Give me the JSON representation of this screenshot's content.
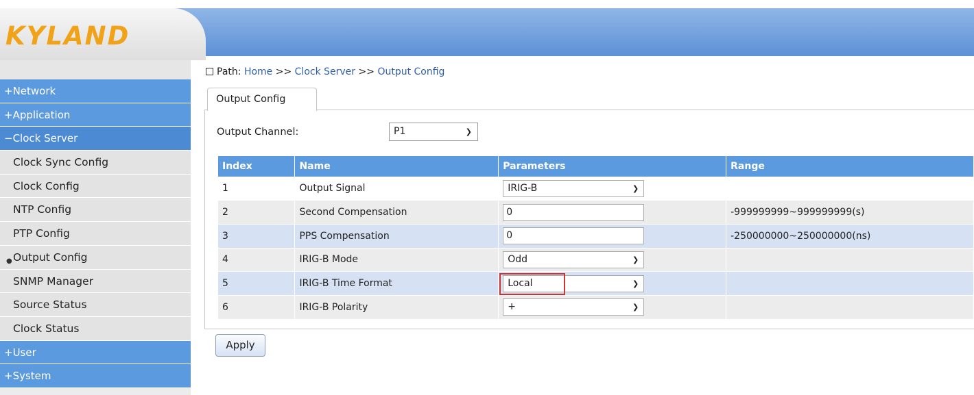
{
  "brand": {
    "logo_text": "KYLAND"
  },
  "sidebar": {
    "items": [
      {
        "label": "+Network",
        "type": "group"
      },
      {
        "label": "+Application",
        "type": "group"
      },
      {
        "label": "−Clock Server",
        "type": "group-open"
      },
      {
        "label": "Clock Sync Config",
        "type": "sub"
      },
      {
        "label": "Clock Config",
        "type": "sub"
      },
      {
        "label": "NTP Config",
        "type": "sub"
      },
      {
        "label": "PTP Config",
        "type": "sub"
      },
      {
        "label": "Output Config",
        "type": "sub-active"
      },
      {
        "label": "SNMP Manager",
        "type": "sub"
      },
      {
        "label": "Source Status",
        "type": "sub"
      },
      {
        "label": "Clock Status",
        "type": "sub"
      },
      {
        "label": "+User",
        "type": "group"
      },
      {
        "label": "+System",
        "type": "group"
      }
    ]
  },
  "path": {
    "prefix": "Path:",
    "home": "Home",
    "sep1": ">>",
    "section": "Clock Server",
    "sep2": ">>",
    "page": "Output Config"
  },
  "tab": {
    "label": "Output Config"
  },
  "channel": {
    "label": "Output Channel:",
    "value": "P1"
  },
  "table": {
    "headers": {
      "index": "Index",
      "name": "Name",
      "parameters": "Parameters",
      "range": "Range"
    },
    "rows": [
      {
        "index": "1",
        "name": "Output Signal",
        "kind": "select",
        "value": "IRIG-B",
        "range": ""
      },
      {
        "index": "2",
        "name": "Second Compensation",
        "kind": "input",
        "value": "0",
        "range": "-999999999~999999999(s)"
      },
      {
        "index": "3",
        "name": "PPS Compensation",
        "kind": "input",
        "value": "0",
        "range": "-250000000~250000000(ns)"
      },
      {
        "index": "4",
        "name": "IRIG-B Mode",
        "kind": "select",
        "value": "Odd",
        "range": ""
      },
      {
        "index": "5",
        "name": "IRIG-B Time Format",
        "kind": "select",
        "value": "Local",
        "range": ""
      },
      {
        "index": "6",
        "name": "IRIG-B Polarity",
        "kind": "select",
        "value": "+",
        "range": ""
      }
    ]
  },
  "apply": {
    "label": "Apply"
  },
  "colors": {
    "header_blue": "#5b9ade",
    "logo_orange": "#f0a318",
    "highlight_red": "#cc3333"
  }
}
